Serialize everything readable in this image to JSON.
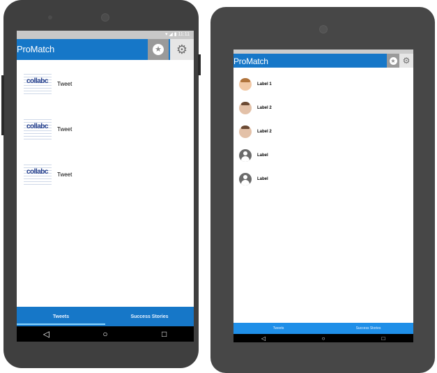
{
  "phone": {
    "status_text": "▾ ◢ ▮ 11:11",
    "app_title": "ProMatch",
    "tweets": [
      {
        "thumb_text": "collabc",
        "label": "Tweet"
      },
      {
        "thumb_text": "collabc",
        "label": "Tweet"
      },
      {
        "thumb_text": "collabc",
        "label": "Tweet"
      }
    ],
    "tabs": [
      "Tweets",
      "Success Stories"
    ],
    "nav": [
      "◁",
      "○",
      "□"
    ]
  },
  "tablet": {
    "app_title": "ProMatch",
    "people": [
      {
        "label": "Label 1",
        "avatar": "photo-avatar"
      },
      {
        "label": "Label 2",
        "avatar": "photo-avatar"
      },
      {
        "label": "Label 2",
        "avatar": "photo-avatar"
      },
      {
        "label": "Label",
        "avatar": "person-icon"
      },
      {
        "label": "Label",
        "avatar": "person-icon"
      }
    ],
    "tabs": [
      "Tweets",
      "Success Stories"
    ],
    "nav": [
      "◁",
      "○",
      "□"
    ]
  },
  "icons": {
    "star": "star-icon",
    "gear": "gear-icon",
    "back": "back-icon",
    "home": "home-icon",
    "recents": "recents-icon"
  },
  "colors": {
    "app_bar": "#1677c8",
    "bottom_tabs_phone": "#1677c8",
    "bottom_tabs_tablet": "#1f8fe8",
    "device_body": "#3f3f3f",
    "screen_bg": "#ffffff"
  }
}
